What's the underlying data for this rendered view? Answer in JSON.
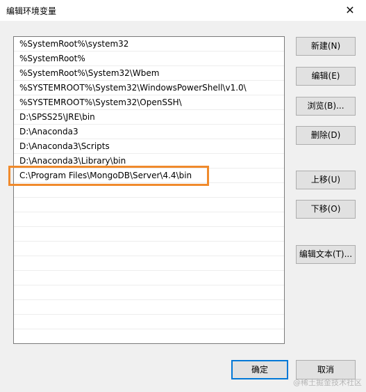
{
  "window": {
    "title": "编辑环境变量",
    "close_glyph": "✕"
  },
  "list": {
    "items": [
      "%SystemRoot%\\system32",
      "%SystemRoot%",
      "%SystemRoot%\\System32\\Wbem",
      "%SYSTEMROOT%\\System32\\WindowsPowerShell\\v1.0\\",
      "%SYSTEMROOT%\\System32\\OpenSSH\\",
      "D:\\SPSS25\\JRE\\bin",
      "D:\\Anaconda3",
      "D:\\Anaconda3\\Scripts",
      "D:\\Anaconda3\\Library\\bin",
      "C:\\Program Files\\MongoDB\\Server\\4.4\\bin"
    ]
  },
  "buttons": {
    "new": "新建(N)",
    "edit": "编辑(E)",
    "browse": "浏览(B)...",
    "delete": "删除(D)",
    "move_up": "上移(U)",
    "move_down": "下移(O)",
    "edit_text": "编辑文本(T)...",
    "ok": "确定",
    "cancel": "取消"
  },
  "watermark": "@稀土掘金技术社区",
  "colors": {
    "highlight": "#f08a2c",
    "focus": "#0078d7"
  }
}
